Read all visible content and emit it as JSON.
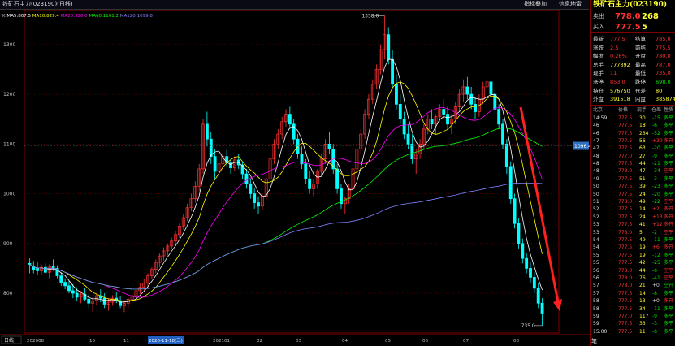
{
  "window": {
    "title": "铁矿石主力(023190)(日线)",
    "buttons": [
      "指标叠加",
      "信息地雷"
    ]
  },
  "indicator_line": {
    "prefix": "K",
    "ma": [
      {
        "label": "MA5:807.5",
        "color": "#ffffff"
      },
      {
        "label": "MA10:829.4",
        "color": "#ffff00"
      },
      {
        "label": "MA20:920.0",
        "color": "#ff00ff"
      },
      {
        "label": "MA60:1101.2",
        "color": "#00ff00"
      },
      {
        "label": "MA120:1099.8",
        "color": "#8080ff"
      }
    ]
  },
  "axis": {
    "y_ticks": [
      "1300",
      "1200",
      "1100",
      "1000",
      "900",
      "800"
    ],
    "x_labels": [
      "202008",
      "10",
      "11",
      "2020-11-18(三)",
      "202101",
      "02",
      "03",
      "04",
      "05",
      "06",
      "07",
      "08"
    ],
    "price_tag": "1096.4",
    "period_label": "日线"
  },
  "annotations": {
    "high": "1358.0",
    "low": "735.0"
  },
  "chart_data": {
    "type": "candlestick",
    "title": "铁矿石主力(023190)(日线)",
    "ylim": [
      720,
      1370
    ],
    "high_marker": 1358.0,
    "low_marker": 735.0,
    "current_line": 1096.4,
    "ohlc": [
      [
        860,
        870,
        840,
        858
      ],
      [
        855,
        865,
        840,
        848
      ],
      [
        850,
        862,
        838,
        845
      ],
      [
        845,
        858,
        836,
        852
      ],
      [
        852,
        860,
        840,
        842
      ],
      [
        842,
        858,
        830,
        855
      ],
      [
        855,
        868,
        845,
        850
      ],
      [
        850,
        856,
        830,
        835
      ],
      [
        835,
        842,
        815,
        822
      ],
      [
        822,
        830,
        808,
        815
      ],
      [
        815,
        825,
        800,
        805
      ],
      [
        805,
        818,
        790,
        800
      ],
      [
        800,
        812,
        785,
        792
      ],
      [
        792,
        805,
        780,
        798
      ],
      [
        798,
        810,
        785,
        788
      ],
      [
        788,
        798,
        770,
        780
      ],
      [
        780,
        792,
        762,
        785
      ],
      [
        785,
        800,
        775,
        795
      ],
      [
        795,
        808,
        782,
        790
      ],
      [
        790,
        800,
        770,
        778
      ],
      [
        778,
        790,
        765,
        782
      ],
      [
        782,
        796,
        775,
        790
      ],
      [
        790,
        802,
        780,
        785
      ],
      [
        785,
        795,
        770,
        775
      ],
      [
        775,
        786,
        762,
        780
      ],
      [
        780,
        792,
        770,
        788
      ],
      [
        788,
        800,
        778,
        795
      ],
      [
        795,
        810,
        788,
        805
      ],
      [
        805,
        820,
        798,
        812
      ],
      [
        812,
        828,
        805,
        820
      ],
      [
        820,
        840,
        812,
        835
      ],
      [
        835,
        852,
        828,
        848
      ],
      [
        848,
        868,
        840,
        862
      ],
      [
        862,
        880,
        852,
        875
      ],
      [
        875,
        892,
        866,
        885
      ],
      [
        885,
        900,
        876,
        895
      ],
      [
        895,
        912,
        888,
        905
      ],
      [
        905,
        925,
        898,
        918
      ],
      [
        918,
        940,
        910,
        935
      ],
      [
        935,
        960,
        928,
        952
      ],
      [
        952,
        980,
        945,
        972
      ],
      [
        972,
        1000,
        965,
        990
      ],
      [
        990,
        1025,
        982,
        1015
      ],
      [
        1015,
        1060,
        1005,
        1050
      ],
      [
        1050,
        1150,
        1040,
        1140
      ],
      [
        1140,
        1165,
        1095,
        1110
      ],
      [
        1110,
        1125,
        1060,
        1075
      ],
      [
        1075,
        1090,
        1030,
        1045
      ],
      [
        1045,
        1070,
        1030,
        1060
      ],
      [
        1060,
        1085,
        1050,
        1075
      ],
      [
        1075,
        1090,
        1055,
        1062
      ],
      [
        1062,
        1070,
        1040,
        1052
      ],
      [
        1052,
        1075,
        1045,
        1068
      ],
      [
        1068,
        1080,
        1050,
        1058
      ],
      [
        1058,
        1065,
        1030,
        1040
      ],
      [
        1040,
        1050,
        1010,
        1020
      ],
      [
        1020,
        1030,
        990,
        1000
      ],
      [
        1000,
        1012,
        970,
        982
      ],
      [
        982,
        995,
        960,
        975
      ],
      [
        975,
        1000,
        968,
        995
      ],
      [
        995,
        1040,
        985,
        1030
      ],
      [
        1030,
        1080,
        1020,
        1070
      ],
      [
        1070,
        1110,
        1060,
        1100
      ],
      [
        1100,
        1130,
        1090,
        1120
      ],
      [
        1120,
        1155,
        1110,
        1145
      ],
      [
        1145,
        1170,
        1135,
        1160
      ],
      [
        1160,
        1175,
        1130,
        1140
      ],
      [
        1140,
        1150,
        1100,
        1110
      ],
      [
        1110,
        1120,
        1070,
        1080
      ],
      [
        1080,
        1095,
        1050,
        1060
      ],
      [
        1060,
        1070,
        1020,
        1030
      ],
      [
        1030,
        1045,
        1000,
        1010
      ],
      [
        1010,
        1030,
        995,
        1020
      ],
      [
        1020,
        1050,
        1010,
        1045
      ],
      [
        1045,
        1080,
        1035,
        1070
      ],
      [
        1070,
        1110,
        1060,
        1100
      ],
      [
        1100,
        1125,
        1080,
        1090
      ],
      [
        1090,
        1100,
        1040,
        1050
      ],
      [
        1050,
        1060,
        1000,
        1010
      ],
      [
        1010,
        1020,
        970,
        980
      ],
      [
        980,
        995,
        960,
        990
      ],
      [
        990,
        1020,
        980,
        1010
      ],
      [
        1010,
        1060,
        1000,
        1050
      ],
      [
        1050,
        1100,
        1040,
        1090
      ],
      [
        1090,
        1130,
        1080,
        1120
      ],
      [
        1120,
        1170,
        1110,
        1160
      ],
      [
        1160,
        1200,
        1150,
        1190
      ],
      [
        1190,
        1230,
        1180,
        1220
      ],
      [
        1220,
        1260,
        1210,
        1250
      ],
      [
        1250,
        1300,
        1240,
        1290
      ],
      [
        1290,
        1358,
        1270,
        1320
      ],
      [
        1320,
        1335,
        1260,
        1270
      ],
      [
        1270,
        1290,
        1210,
        1220
      ],
      [
        1220,
        1240,
        1170,
        1180
      ],
      [
        1180,
        1200,
        1140,
        1150
      ],
      [
        1150,
        1165,
        1110,
        1120
      ],
      [
        1120,
        1140,
        1090,
        1100
      ],
      [
        1100,
        1120,
        1060,
        1070
      ],
      [
        1070,
        1090,
        1040,
        1080
      ],
      [
        1080,
        1110,
        1070,
        1100
      ],
      [
        1100,
        1140,
        1090,
        1130
      ],
      [
        1130,
        1160,
        1120,
        1150
      ],
      [
        1150,
        1170,
        1130,
        1140
      ],
      [
        1140,
        1160,
        1120,
        1155
      ],
      [
        1155,
        1180,
        1145,
        1170
      ],
      [
        1170,
        1190,
        1150,
        1160
      ],
      [
        1160,
        1175,
        1130,
        1140
      ],
      [
        1140,
        1160,
        1120,
        1150
      ],
      [
        1150,
        1185,
        1140,
        1175
      ],
      [
        1175,
        1210,
        1165,
        1200
      ],
      [
        1200,
        1230,
        1185,
        1215
      ],
      [
        1215,
        1235,
        1190,
        1200
      ],
      [
        1200,
        1215,
        1170,
        1180
      ],
      [
        1180,
        1195,
        1150,
        1165
      ],
      [
        1165,
        1200,
        1155,
        1190
      ],
      [
        1190,
        1225,
        1180,
        1215
      ],
      [
        1215,
        1240,
        1200,
        1225
      ],
      [
        1225,
        1235,
        1190,
        1200
      ],
      [
        1200,
        1210,
        1160,
        1170
      ],
      [
        1170,
        1180,
        1130,
        1140
      ],
      [
        1140,
        1150,
        1090,
        1100
      ],
      [
        1100,
        1110,
        1040,
        1055
      ],
      [
        1055,
        1065,
        980,
        990
      ],
      [
        990,
        1000,
        930,
        940
      ],
      [
        940,
        950,
        890,
        900
      ],
      [
        900,
        910,
        860,
        870
      ],
      [
        870,
        880,
        840,
        850
      ],
      [
        850,
        862,
        820,
        832
      ],
      [
        832,
        842,
        800,
        810
      ],
      [
        810,
        820,
        770,
        780
      ],
      [
        780,
        790,
        735,
        760
      ]
    ],
    "ma_series": [
      {
        "name": "MA5",
        "value": "807.5",
        "color": "#ffffff"
      },
      {
        "name": "MA10",
        "value": "829.4",
        "color": "#ffff00"
      },
      {
        "name": "MA20",
        "value": "920.0",
        "color": "#ff00ff"
      },
      {
        "name": "MA60",
        "value": "1101.2",
        "color": "#00ff00"
      },
      {
        "name": "MA120",
        "value": "1099.8",
        "color": "#8080ff"
      }
    ]
  },
  "panel": {
    "title": "铁矿石主力(023190)",
    "sell": {
      "label": "卖出",
      "price": "778.0",
      "qty": "268"
    },
    "buy": {
      "label": "买入",
      "price": "777.5",
      "qty": "5"
    },
    "quote": [
      [
        "最新",
        "777.5",
        "结算",
        "785.0"
      ],
      [
        "涨跌",
        "2.5",
        "前结",
        "775.5"
      ],
      [
        "幅度",
        "0.26%",
        "开盘",
        "780.0"
      ],
      [
        "总手",
        "777392",
        "最高",
        "787.0"
      ],
      [
        "现手",
        "11",
        "最低",
        "735.0"
      ],
      [
        "涨停",
        "853.0",
        "跌停",
        "698.0"
      ],
      [
        "持仓",
        "576750",
        "仓差",
        "80"
      ],
      [
        "外盘",
        "391518",
        "内盘",
        "385874"
      ]
    ],
    "ticks_header": [
      "北京",
      "价格",
      "现手",
      "仓差",
      "性质"
    ],
    "ticks": [
      [
        "14:59",
        "777.5",
        "30",
        "-15",
        "多平"
      ],
      [
        "46",
        "777.5",
        "18",
        "-6",
        "多平"
      ],
      [
        "46",
        "777.5",
        "234",
        "-52",
        "多平"
      ],
      [
        "47",
        "777.5",
        "56",
        "+30",
        "多开"
      ],
      [
        "47",
        "777.5",
        "63",
        "-20",
        "多平"
      ],
      [
        "48",
        "777.0",
        "27",
        "-9",
        "多平"
      ],
      [
        "48",
        "777.5",
        "44",
        "-21",
        "多平"
      ],
      [
        "48",
        "778.0",
        "47",
        "-34",
        "空平"
      ],
      [
        "49",
        "777.5",
        "51",
        "-3",
        "多平"
      ],
      [
        "50",
        "777.5",
        "39",
        "-23",
        "多平"
      ],
      [
        "50",
        "777.5",
        "24",
        "-20",
        "多平"
      ],
      [
        "51",
        "778.0",
        "49",
        "-22",
        "空平"
      ],
      [
        "52",
        "777.5",
        "14",
        "+2",
        "多开"
      ],
      [
        "52",
        "777.5",
        "24",
        "+13",
        "多开"
      ],
      [
        "53",
        "777.5",
        "41",
        "+12",
        "多开"
      ],
      [
        "53",
        "778.0",
        "5",
        "-2",
        "空平"
      ],
      [
        "54",
        "777.5",
        "49",
        "-11",
        "多平"
      ],
      [
        "54",
        "777.5",
        "19",
        "+6",
        "多开"
      ],
      [
        "55",
        "777.5",
        "19",
        "-12",
        "多平"
      ],
      [
        "55",
        "777.5",
        "42",
        "-25",
        "多平"
      ],
      [
        "56",
        "778.0",
        "44",
        "-6",
        "空平"
      ],
      [
        "56",
        "778.0",
        "76",
        "-41",
        "空平"
      ],
      [
        "57",
        "778.0",
        "21",
        "+0",
        "空开"
      ],
      [
        "57",
        "777.5",
        "14",
        "-8",
        "多平"
      ],
      [
        "58",
        "777.5",
        "13",
        "+0",
        "多开"
      ],
      [
        "58",
        "777.5",
        "34",
        "-11",
        "多平"
      ],
      [
        "59",
        "777.0",
        "117",
        "-9",
        "多平"
      ],
      [
        "59",
        "777.5",
        "33",
        "-3",
        "多平"
      ],
      [
        "15:00",
        "777.5",
        "11",
        "-6",
        "多平"
      ]
    ],
    "bottom_tab": "笔"
  }
}
